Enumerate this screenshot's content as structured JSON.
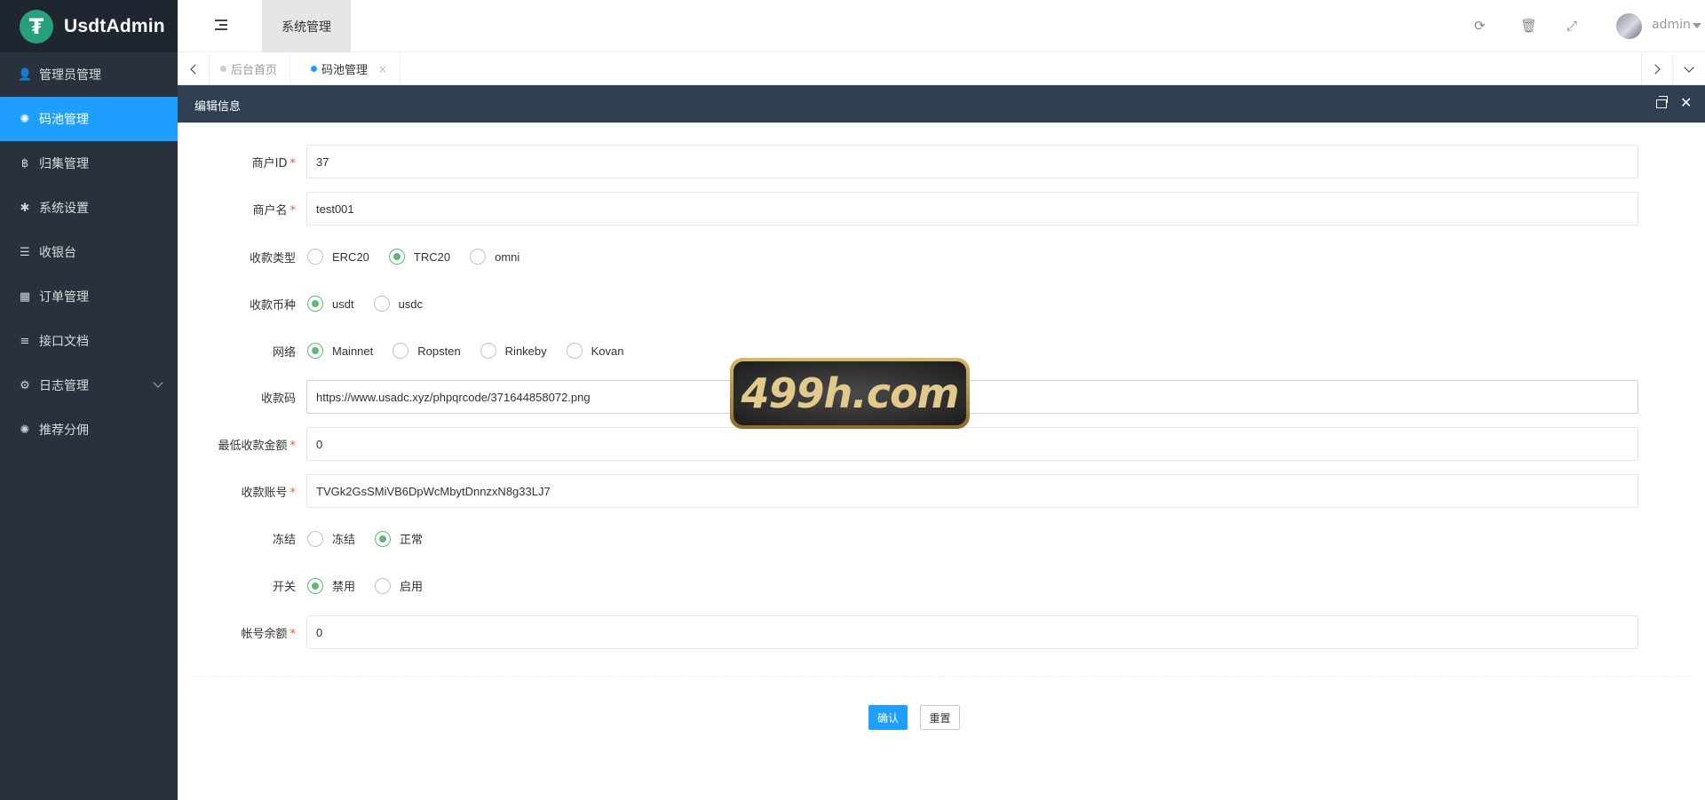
{
  "app": {
    "brand_logo_glyph": "₮",
    "brand_title": "UsdtAdmin",
    "brand_color": "#26a17b",
    "accent_color": "#1e9fff",
    "check_color": "#5fb878"
  },
  "sidebar": {
    "items": [
      {
        "label": "管理员管理",
        "icon": "user-icon",
        "glyph": "👤"
      },
      {
        "label": "码池管理",
        "icon": "android-icon",
        "glyph": "✺"
      },
      {
        "label": "归集管理",
        "icon": "bitcoin-icon",
        "glyph": "฿"
      },
      {
        "label": "系统设置",
        "icon": "gear-icon",
        "glyph": "✱"
      },
      {
        "label": "收银台",
        "icon": "list-icon",
        "glyph": "☰"
      },
      {
        "label": "订单管理",
        "icon": "calculator-icon",
        "glyph": "▦"
      },
      {
        "label": "接口文档",
        "icon": "align-left-icon",
        "glyph": "≡"
      },
      {
        "label": "日志管理",
        "icon": "log-icon",
        "glyph": "⚙"
      },
      {
        "label": "推荐分佣",
        "icon": "android-icon",
        "glyph": "✺"
      }
    ],
    "active_index": 1
  },
  "header": {
    "tab_label": "系统管理",
    "refresh_glyph": "⟳",
    "trash_glyph": "🗑",
    "fullscreen_glyph": "⤢",
    "username": "admin"
  },
  "tabs": {
    "items": [
      {
        "label": "后台首页"
      },
      {
        "label": "码池管理",
        "close": "×"
      }
    ]
  },
  "panel": {
    "title": "编辑信息",
    "close_glyph": "✕"
  },
  "form": {
    "merchant_id": {
      "label": "商户ID",
      "value": "37"
    },
    "merchant_name": {
      "label": "商户名",
      "value": "test001"
    },
    "pay_type": {
      "label": "收款类型",
      "options": [
        "ERC20",
        "TRC20",
        "omni"
      ],
      "selected": "TRC20"
    },
    "currency": {
      "label": "收款币种",
      "options": [
        "usdt",
        "usdc"
      ],
      "selected": "usdt"
    },
    "network": {
      "label": "网络",
      "options": [
        "Mainnet",
        "Ropsten",
        "Rinkeby",
        "Kovan"
      ],
      "selected": "Mainnet"
    },
    "qrcode": {
      "label": "收款码",
      "value": "https://www.usadc.xyz/phpqrcode/371644858072.png"
    },
    "min_amount": {
      "label": "最低收款金额",
      "value": "0"
    },
    "account": {
      "label": "收款账号",
      "value": "TVGk2GsSMiVB6DpWcMbytDnnzxN8g33LJ7"
    },
    "freeze": {
      "label": "冻结",
      "options": [
        "冻结",
        "正常"
      ],
      "selected": "正常"
    },
    "switch": {
      "label": "开关",
      "options": [
        "禁用",
        "启用"
      ],
      "selected": "禁用"
    },
    "balance": {
      "label": "帐号余额",
      "value": "0"
    },
    "required_mark": "*"
  },
  "buttons": {
    "confirm": "确认",
    "reset": "重置"
  },
  "watermark": {
    "text": "499h.com"
  }
}
